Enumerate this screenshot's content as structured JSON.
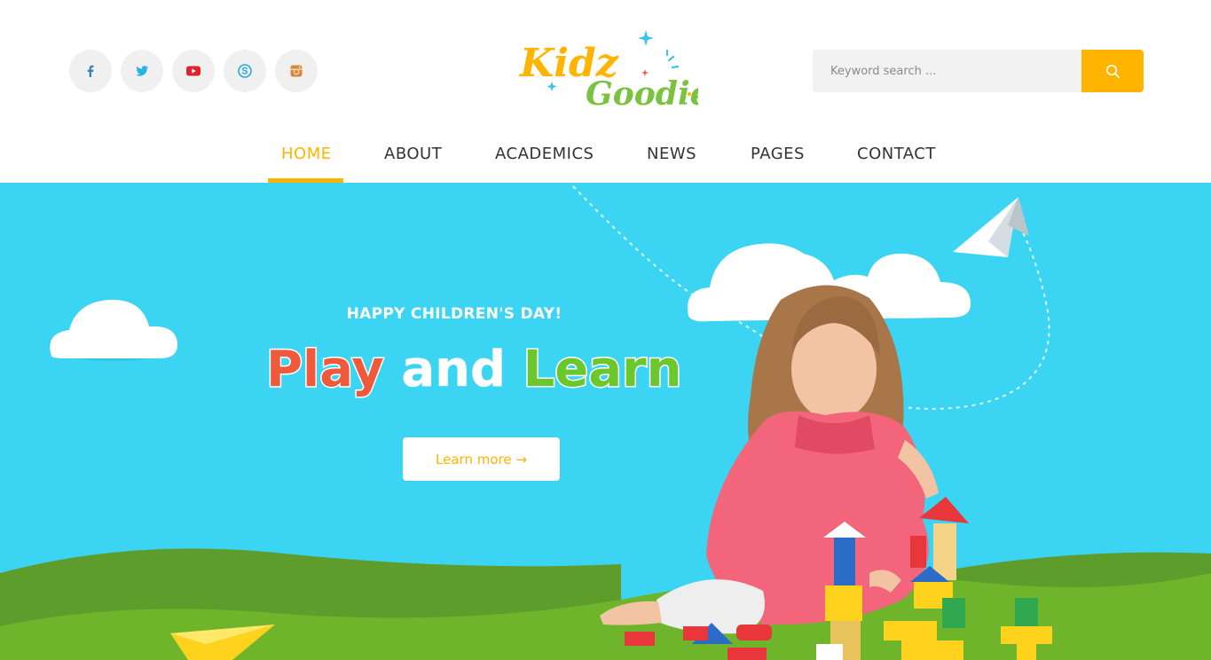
{
  "socials": [
    {
      "name": "facebook-icon",
      "color": "#3b82c4"
    },
    {
      "name": "twitter-icon",
      "color": "#29b3e8"
    },
    {
      "name": "youtube-icon",
      "color": "#e0232b"
    },
    {
      "name": "skype-icon",
      "color": "#29a8e0"
    },
    {
      "name": "instagram-icon",
      "color": "#d48a3a"
    }
  ],
  "logo": {
    "line1": "Kidz",
    "line2": "Goodie"
  },
  "search": {
    "placeholder": "Keyword search ...",
    "icon": "search-icon"
  },
  "nav": {
    "items": [
      {
        "label": "HOME",
        "active": true
      },
      {
        "label": "ABOUT",
        "active": false
      },
      {
        "label": "ACADEMICS",
        "active": false
      },
      {
        "label": "NEWS",
        "active": false
      },
      {
        "label": "PAGES",
        "active": false
      },
      {
        "label": "CONTACT",
        "active": false
      }
    ]
  },
  "hero": {
    "eyebrow": "HAPPY CHILDREN'S DAY!",
    "title_word1": "Play",
    "title_word2": "and",
    "title_word3": "Learn",
    "button_label": "Learn more →"
  },
  "colors": {
    "accent": "#ffb400",
    "sky": "#3bd4f2",
    "grass": "#6fb52c",
    "title_red": "#f05a3c",
    "title_green": "#6cc72c"
  }
}
